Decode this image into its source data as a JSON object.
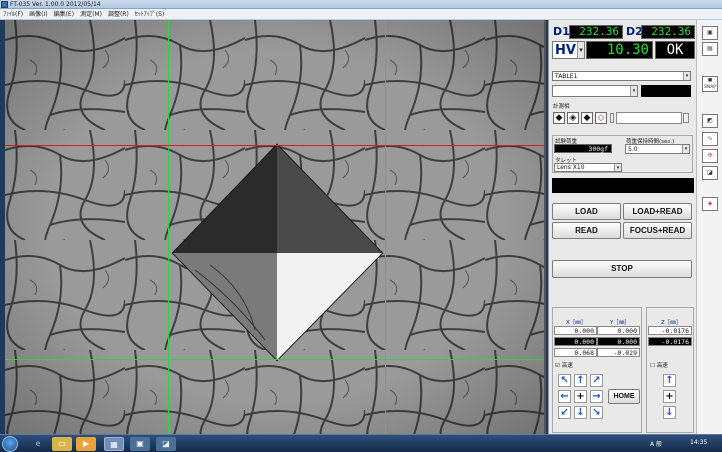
{
  "window": {
    "title": "FT-035 Ver. 1.00.0   2012/05/14",
    "menu": [
      "ﾌｧｲﾙ(F)",
      "画像(I)",
      "編集(E)",
      "測定(M)",
      "調整(R)",
      "ｾｯﾄｱｯﾌﾟ(S)"
    ]
  },
  "readout": {
    "d1_label": "D1",
    "d1_value": "232.36",
    "d2_label": "D2",
    "d2_value": "232.36",
    "scale_label": "HV",
    "scale_value": "10.30",
    "judgement": "OK"
  },
  "table": {
    "selected": "TABLE1",
    "second": ""
  },
  "mode": {
    "label": "計測相"
  },
  "test": {
    "load_label": "試験荷重",
    "load_value": "300gf",
    "dwell_label": "荷重保持時間(sec.)",
    "dwell_value": "5.0",
    "turret_label": "タレット",
    "turret_value": "Lens X10"
  },
  "buttons": {
    "load": "LOAD",
    "load_read": "LOAD+READ",
    "read": "READ",
    "focus_read": "FOCUS+READ",
    "stop": "STOP",
    "home": "HOME"
  },
  "stage": {
    "x_label": "X［㎜］",
    "y_label": "Y［㎜］",
    "z_label": "Z［㎜］",
    "x_values": [
      "0.000",
      "0.000",
      "0.068"
    ],
    "y_values": [
      "0.000",
      "0.000",
      "-0.029"
    ],
    "z_values": [
      "-0.0176",
      "-0.0176"
    ],
    "xy_fast_label": "高速",
    "z_fast_label": "高速"
  },
  "side_toolbar": {
    "snap": "SNAP"
  },
  "taskbar": {
    "tray": "A 般",
    "time": "14:35"
  },
  "colors": {
    "lcd_text": "#22e22a",
    "crosshair_green": "#2fd23f",
    "crosshair_red": "#d42020",
    "accent_blue": "#00207a"
  }
}
